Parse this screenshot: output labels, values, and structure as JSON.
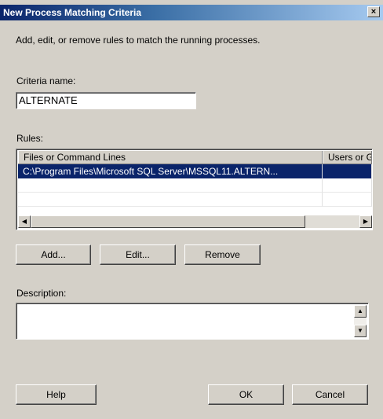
{
  "window": {
    "title": "New Process Matching Criteria",
    "close_glyph": "×"
  },
  "intro": "Add, edit, or remove rules to match the running processes.",
  "criteria": {
    "label": "Criteria name:",
    "value": "ALTERNATE"
  },
  "rules": {
    "label": "Rules:",
    "columns": [
      "Files or Command Lines",
      "Users or G"
    ],
    "rows": [
      [
        "C:\\Program Files\\Microsoft SQL Server\\MSSQL11.ALTERN...",
        ""
      ]
    ]
  },
  "buttons": {
    "add": "Add...",
    "edit": "Edit...",
    "remove": "Remove",
    "help": "Help",
    "ok": "OK",
    "cancel": "Cancel"
  },
  "description": {
    "label": "Description:",
    "value": ""
  },
  "icons": {
    "close": "close-icon",
    "scroll_left": "arrow-left-icon",
    "scroll_right": "arrow-right-icon",
    "scroll_up": "arrow-up-icon",
    "scroll_down": "arrow-down-icon"
  },
  "colors": {
    "title_start": "#0a246a",
    "title_end": "#a6caf0",
    "selection": "#0a246a",
    "dialog": "#d4d0c8"
  }
}
